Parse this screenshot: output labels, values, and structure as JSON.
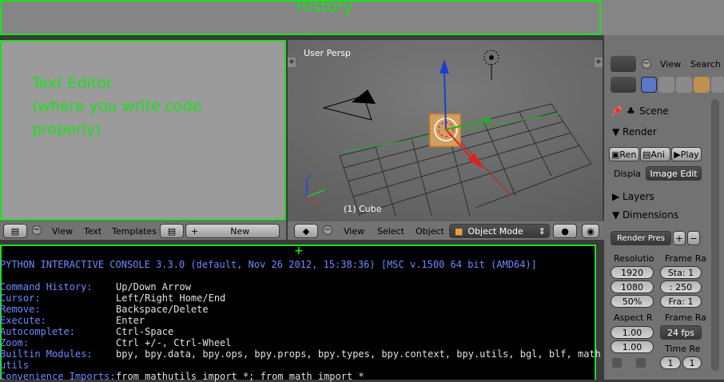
{
  "history": {
    "label": "History"
  },
  "text_editor": {
    "note": "Text Editor\n(where you write code\nproperly)",
    "header": {
      "view": "View",
      "text": "Text",
      "templates": "Templates",
      "new": "New"
    }
  },
  "viewport": {
    "persp_label": "User Persp",
    "object_label": "(1) Cube",
    "header": {
      "view": "View",
      "select": "Select",
      "object": "Object",
      "mode": "Object Mode"
    },
    "plus": "+"
  },
  "console": {
    "plus": "+",
    "banner": "PYTHON INTERACTIVE CONSOLE 3.3.0 (default, Nov 26 2012, 15:38:36) [MSC v.1500 64 bit (AMD64)]",
    "rows": [
      {
        "key": "Command History:",
        "value": "Up/Down Arrow"
      },
      {
        "key": "Cursor:",
        "value": "Left/Right Home/End"
      },
      {
        "key": "Remove:",
        "value": "Backspace/Delete"
      },
      {
        "key": "Execute:",
        "value": "Enter"
      },
      {
        "key": "Autocomplete:",
        "value": "Ctrl-Space"
      },
      {
        "key": "Zoom:",
        "value": "Ctrl +/-, Ctrl-Wheel"
      },
      {
        "key": "Builtin Modules:",
        "value": "bpy, bpy.data, bpy.ops, bpy.props, bpy.types, bpy.context, bpy.utils, bgl, blf, math"
      },
      {
        "key": "utils",
        "value": ""
      },
      {
        "key": "Convenience Imports:",
        "value": "from mathutils import *; from math import *"
      }
    ]
  },
  "properties": {
    "view": "View",
    "search": "Search",
    "scene": "Scene",
    "render_panel": "Render",
    "buttons": [
      "Ren",
      "Ani",
      "Play"
    ],
    "display_label": "Displa",
    "display_value": "Image Edit",
    "layers_panel": "Layers",
    "dimensions_panel": "Dimensions",
    "render_presets": "Render Pres",
    "resolution_label": "Resolutio",
    "res_x": "1920",
    "res_y": "1080",
    "res_pct": "50%",
    "frame_range_label": "Frame Ra",
    "frame_start": "Sta: 1",
    "frame_end": ": 250",
    "frame_step": "Fra: 1",
    "aspect_label": "Aspect R",
    "aspect_x": "1.00",
    "aspect_y": "1.00",
    "frame_rate_label": "Frame Ra",
    "fps": "24 fps",
    "time_remap_label": "Time Re",
    "time_old": "1",
    "time_new": "1"
  }
}
